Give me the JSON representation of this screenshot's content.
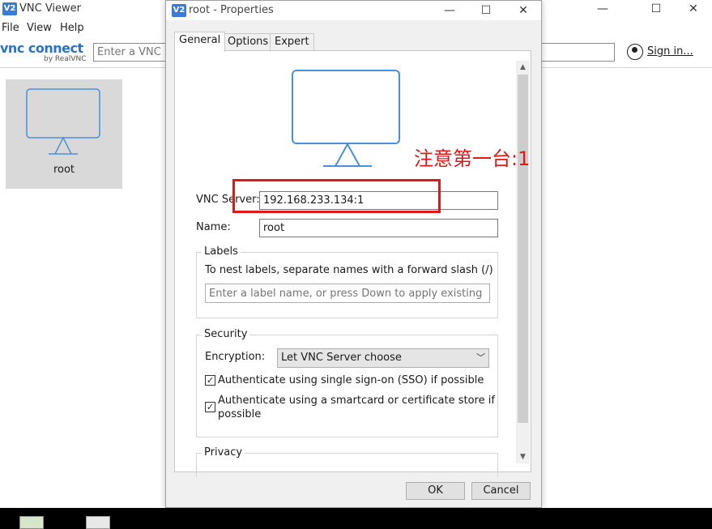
{
  "main_window": {
    "logo": "V2",
    "title": "VNC Viewer",
    "controls": {
      "minimize": "—",
      "maximize": "☐",
      "close": "✕"
    },
    "menu": [
      "File",
      "View",
      "Help"
    ],
    "brand": {
      "name": "vnc connect",
      "sub": "by RealVNC"
    },
    "address_placeholder": "Enter a VNC Se",
    "signin_label": "Sign in...",
    "server_tile": {
      "name": "root",
      "icon": "monitor-icon"
    }
  },
  "dialog": {
    "logo": "V2",
    "title": "root - Properties",
    "controls": {
      "minimize": "—",
      "maximize": "☐",
      "close": "✕"
    },
    "tabs": [
      "General",
      "Options",
      "Expert"
    ],
    "active_tab": "General",
    "preview_icon": "monitor-icon",
    "vnc_server_label": "VNC Server:",
    "vnc_server_value": "192.168.233.134:1",
    "name_label": "Name:",
    "name_value": "root",
    "labels_group": {
      "title": "Labels",
      "hint": "To nest labels, separate names with a forward slash (/)",
      "placeholder": "Enter a label name, or press Down to apply existing labels"
    },
    "security_group": {
      "title": "Security",
      "encryption_label": "Encryption:",
      "encryption_value": "Let VNC Server choose",
      "checkbox_sso": {
        "label": "Authenticate using single sign-on (SSO) if possible",
        "checked": true
      },
      "checkbox_smartcard": {
        "line1": "Authenticate using a smartcard or certificate store if",
        "line2": "possible",
        "checked": true
      }
    },
    "privacy_group": {
      "title": "Privacy"
    },
    "buttons": {
      "ok": "OK",
      "cancel": "Cancel"
    }
  },
  "annotation": {
    "text": "注意第一台:1",
    "color": "#e01818"
  }
}
